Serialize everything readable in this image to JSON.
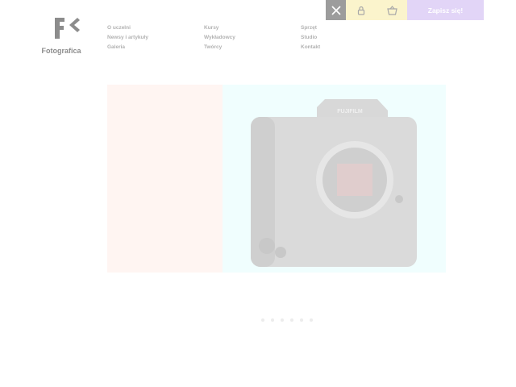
{
  "brand": {
    "name": "Fotografica"
  },
  "nav": {
    "col1": [
      "O uczelni",
      "Newsy i artykuły",
      "Galeria"
    ],
    "col2": [
      "Kursy",
      "Wykładowcy",
      "Twórcy"
    ],
    "col3": [
      "Sprzęt",
      "Studio",
      "Kontakt"
    ]
  },
  "topbar": {
    "close_icon": "close-icon",
    "user_icon": "user-icon",
    "cart_icon": "basket-icon",
    "subscribe_label": "Zapisz się!"
  },
  "hero": {
    "image": "camera-body-image",
    "camera_brand": "FUJIFILM"
  },
  "slider": {
    "count": 6,
    "active": 0
  },
  "colors": {
    "close_bg": "#9c9c9c",
    "icon_bg": "#fbf4cc",
    "subscribe_bg": "#e2d5f7",
    "hero_left": "#fff5f2",
    "hero_right": "#f0fefe"
  }
}
